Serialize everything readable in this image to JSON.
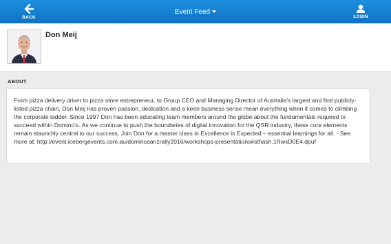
{
  "header": {
    "back_label": "BACK",
    "title": "Event Feed",
    "login_label": "LOGIN"
  },
  "profile": {
    "name": "Don Meij"
  },
  "about": {
    "heading": "ABOUT",
    "text": "From pizza delivery driver to pizza store entrepreneur, to Group CEO and Managing Director of Australia's largest and first publicly-listed pizza chain, Don Meij has proven passion, dedication and a keen business sense mean everything when it comes to climbing the corporate ladder. Since 1997 Don has been educating team members around the globe about the fundamentals required to succeed within Domino's. As we continue to push the boundaries of digital innovation for the QSR industry, these core elements remain staunchly central to our success. Join Don for a master class in Excellence is Expected – essential learnings for all. - See more at: http://event.icebergevents.com.au/dominosanzrally2016/workshops-presentations#sthash.1RwxD0E4.dpuf"
  },
  "colors": {
    "header_bg": "#1a84d6",
    "page_bg": "#ececec"
  }
}
